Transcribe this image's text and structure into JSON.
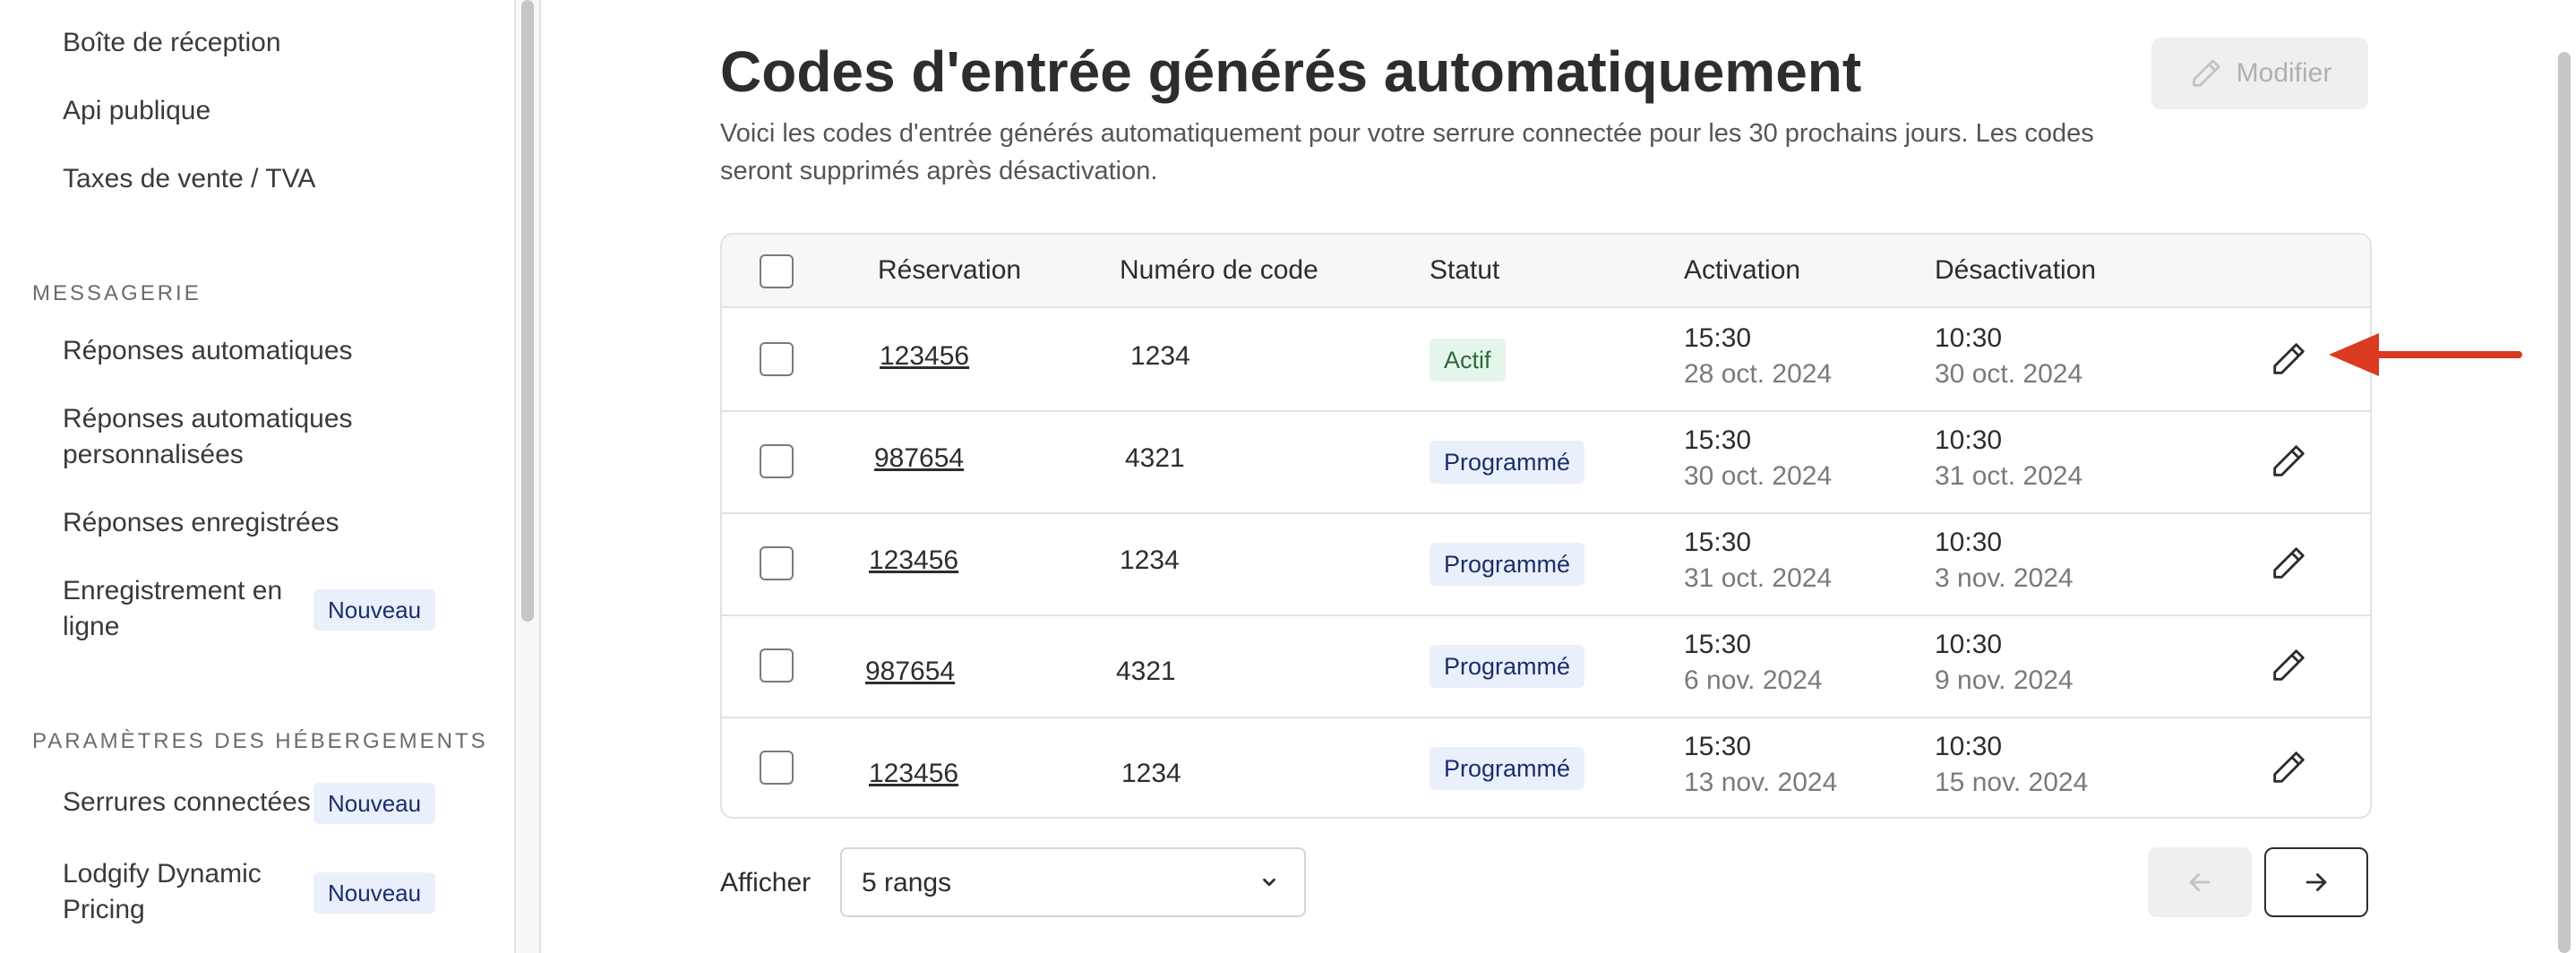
{
  "sidebar": {
    "items_top": [
      "Boîte de réception",
      "Api publique",
      "Taxes de vente / TVA"
    ],
    "messaging_heading": "MESSAGERIE",
    "messaging_items": [
      {
        "line1": "Réponses automatiques",
        "line2": ""
      },
      {
        "line1": "Réponses automatiques",
        "line2": "personnalisées"
      },
      {
        "line1": "Réponses enregistrées",
        "line2": ""
      },
      {
        "line1": "Enregistrement en",
        "line2": "ligne",
        "badge": "Nouveau"
      }
    ],
    "accommodation_heading": "PARAMÈTRES DES HÉBERGEMENTS",
    "accommodation_items": [
      {
        "line1": "Serrures connectées",
        "line2": "",
        "badge": "Nouveau"
      },
      {
        "line1": "Lodgify Dynamic",
        "line2": "Pricing",
        "badge": "Nouveau"
      }
    ]
  },
  "main": {
    "title": "Codes d'entrée générés automatiquement",
    "description": "Voici les codes d'entrée générés automatiquement pour votre serrure connectée pour les 30 prochains jours. Les codes seront supprimés après désactivation.",
    "edit_button": "Modifier"
  },
  "table": {
    "headers": {
      "reservation": "Réservation",
      "code": "Numéro de code",
      "status": "Statut",
      "activation": "Activation",
      "deactivation": "Désactivation"
    },
    "rows": [
      {
        "reservation": "123456",
        "code": "1234",
        "status": "Actif",
        "status_kind": "active",
        "act_time": "15:30",
        "act_date": "28 oct. 2024",
        "deact_time": "10:30",
        "deact_date": "30 oct. 2024"
      },
      {
        "reservation": "987654",
        "code": "4321",
        "status": "Programmé",
        "status_kind": "scheduled",
        "act_time": "15:30",
        "act_date": "30 oct. 2024",
        "deact_time": "10:30",
        "deact_date": "31 oct. 2024"
      },
      {
        "reservation": "123456",
        "code": "1234",
        "status": "Programmé",
        "status_kind": "scheduled",
        "act_time": "15:30",
        "act_date": "31 oct. 2024",
        "deact_time": "10:30",
        "deact_date": "3 nov. 2024"
      },
      {
        "reservation": "987654",
        "code": "4321",
        "status": "Programmé",
        "status_kind": "scheduled",
        "act_time": "15:30",
        "act_date": "6 nov. 2024",
        "deact_time": "10:30",
        "deact_date": "9 nov. 2024"
      },
      {
        "reservation": "123456",
        "code": "1234",
        "status": "Programmé",
        "status_kind": "scheduled",
        "act_time": "15:30",
        "act_date": "13 nov. 2024",
        "deact_time": "10:30",
        "deact_date": "15 nov. 2024"
      }
    ]
  },
  "footer": {
    "show_label": "Afficher",
    "rows_per_page": "5 rangs"
  },
  "icons": {
    "edit": "pencil-icon",
    "prev": "arrow-left-icon",
    "next": "arrow-right-icon",
    "select": "chevron-down-icon",
    "annotation": "red-arrow-icon"
  },
  "colors": {
    "annotation_arrow": "#d93a20",
    "active_badge_bg": "#e6f5ea",
    "scheduled_badge_bg": "#e9f0fb"
  }
}
